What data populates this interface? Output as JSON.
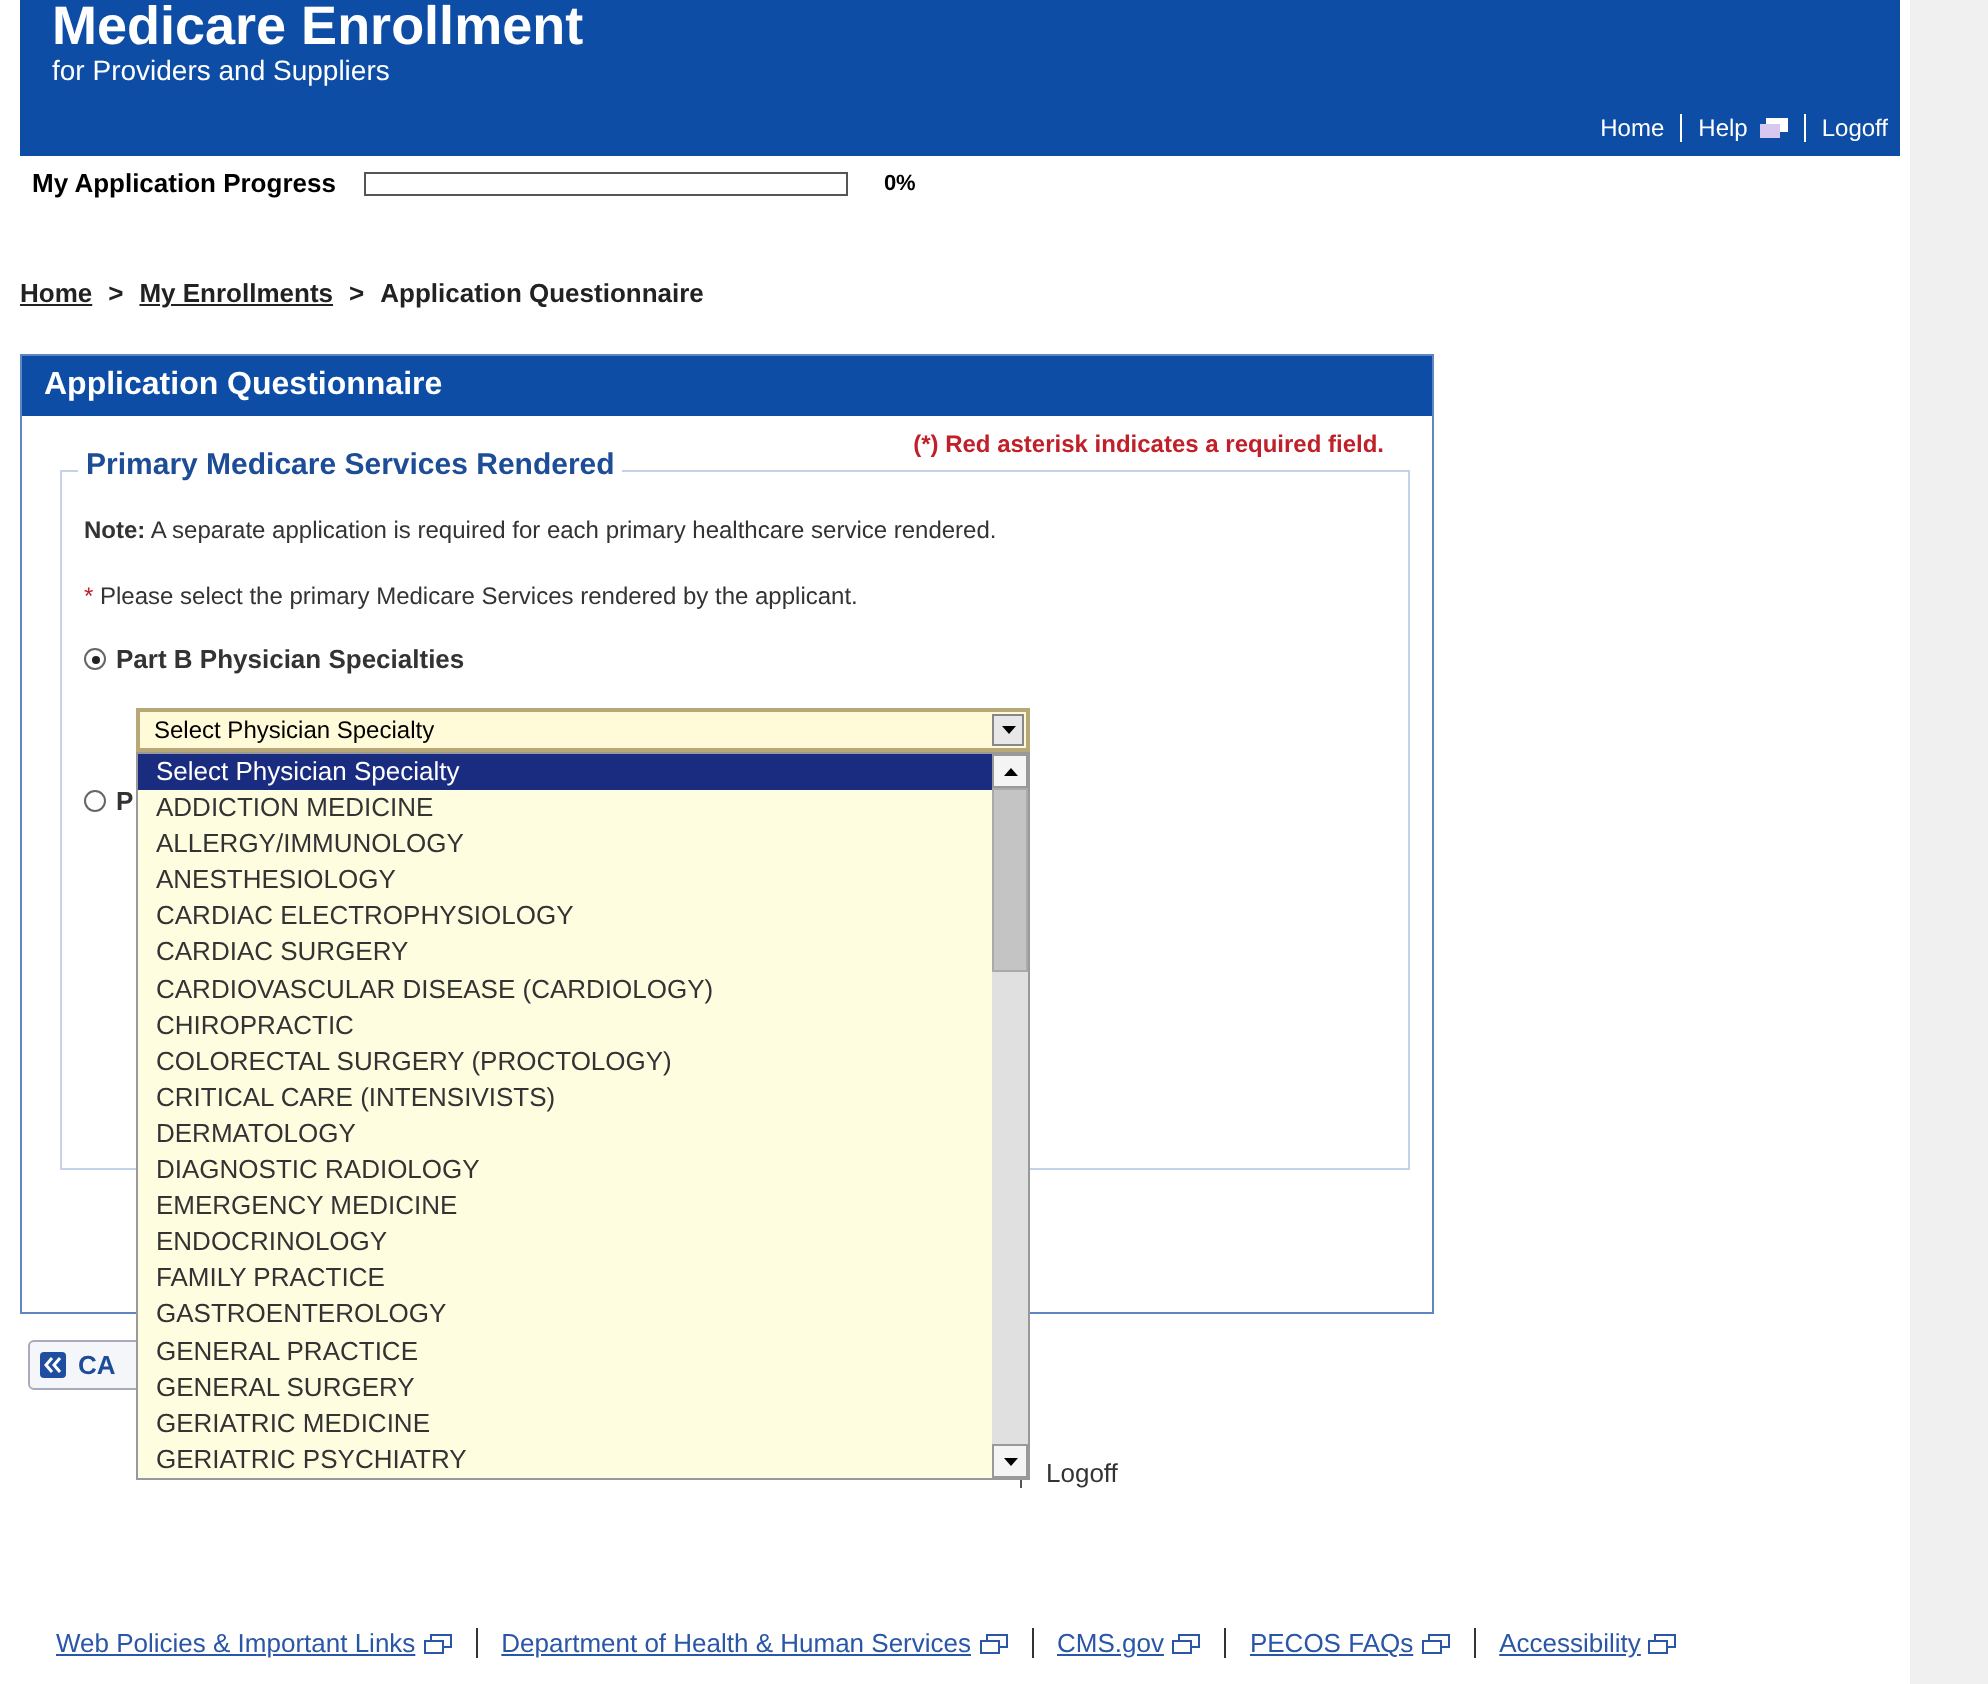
{
  "header": {
    "title": "Medicare Enrollment",
    "subtitle": "for Providers and Suppliers",
    "links": [
      {
        "label": "Home",
        "external": false
      },
      {
        "label": "Help",
        "external": true
      },
      {
        "label": "Logoff",
        "external": false
      }
    ]
  },
  "progress": {
    "label": "My Application Progress",
    "level": 0,
    "reading": "0%"
  },
  "breadcrumb": [
    {
      "label": "Home",
      "link": true
    },
    {
      "label": "My Enrollments",
      "link": true
    },
    {
      "label": "Application Questionnaire",
      "link": false
    }
  ],
  "breadcrumb_separator": ">",
  "panel": {
    "title": "Application Questionnaire",
    "required_note": "(*) Red asterisk indicates a required field.",
    "section_title": "Primary Medicare Services Rendered",
    "note_label": "Note:",
    "note_text": "A separate application is required for each primary healthcare service rendered.",
    "prompt_mark": "*",
    "prompt": "Please select the primary Medicare Services rendered by the applicant.",
    "options": [
      {
        "label": "Part B Physician Specialties",
        "selected": true
      },
      {
        "label": "P",
        "selected": false
      }
    ],
    "select": {
      "value": "Select Physician Specialty",
      "expanded": true
    }
  },
  "dropdown_items": [
    {
      "label": "Select Physician Specialty",
      "selected": true
    },
    {
      "label": "ADDICTION MEDICINE",
      "selected": false
    },
    {
      "label": "ALLERGY/IMMUNOLOGY",
      "selected": false
    },
    {
      "label": "ANESTHESIOLOGY",
      "selected": false
    },
    {
      "label": "CARDIAC ELECTROPHYSIOLOGY",
      "selected": false
    },
    {
      "label": "CARDIAC SURGERY",
      "selected": false
    },
    {
      "label": "CARDIOVASCULAR DISEASE (CARDIOLOGY)",
      "selected": false
    },
    {
      "label": "CHIROPRACTIC",
      "selected": false
    },
    {
      "label": "COLORECTAL SURGERY (PROCTOLOGY)",
      "selected": false
    },
    {
      "label": "CRITICAL CARE (INTENSIVISTS)",
      "selected": false
    },
    {
      "label": "DERMATOLOGY",
      "selected": false
    },
    {
      "label": "DIAGNOSTIC RADIOLOGY",
      "selected": false
    },
    {
      "label": "EMERGENCY MEDICINE",
      "selected": false
    },
    {
      "label": "ENDOCRINOLOGY",
      "selected": false
    },
    {
      "label": "FAMILY PRACTICE",
      "selected": false
    },
    {
      "label": "GASTROENTEROLOGY",
      "selected": false
    },
    {
      "label": "GENERAL PRACTICE",
      "selected": false
    },
    {
      "label": "GENERAL SURGERY",
      "selected": false
    },
    {
      "label": "GERIATRIC MEDICINE",
      "selected": false
    },
    {
      "label": "GERIATRIC PSYCHIATRY",
      "selected": false
    }
  ],
  "cancel_button": {
    "label": "CA"
  },
  "footer_nav": [
    {
      "label": "Logoff"
    }
  ],
  "footer_links": [
    {
      "label": "Web Policies & Important Links",
      "external": true
    },
    {
      "label": "Department of Health & Human Services",
      "external": true
    },
    {
      "label": "CMS.gov",
      "external": true
    },
    {
      "label": "PECOS FAQs",
      "external": true
    },
    {
      "label": "Accessibility",
      "external": true
    }
  ]
}
